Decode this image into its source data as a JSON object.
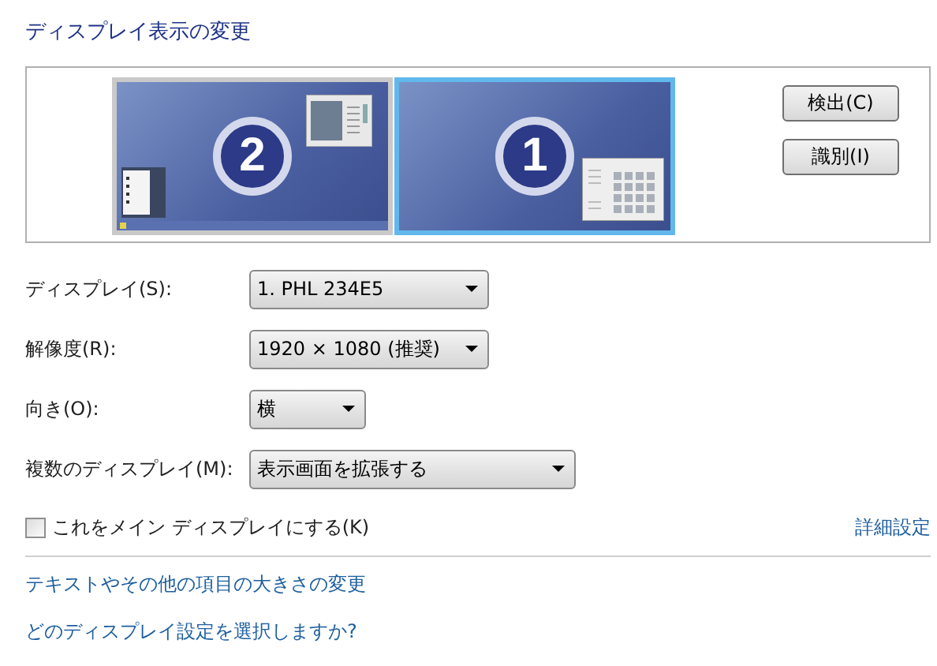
{
  "title": "ディスプレイ表示の変更",
  "monitors": [
    {
      "number": "2",
      "selected": false
    },
    {
      "number": "1",
      "selected": true
    }
  ],
  "buttons": [
    "検出(C)",
    "識別(I)"
  ],
  "settings": [
    {
      "label": "ディスプレイ(S):",
      "value": "1. PHL 234E5"
    },
    {
      "label": "解像度(R):",
      "value": "1920 × 1080 (推奨)"
    },
    {
      "label": "向き(O):",
      "value": "横"
    },
    {
      "label": "複数のディスプレイ(M):",
      "value": "表示画面を拡張する"
    }
  ],
  "main_display": {
    "label": "これをメイン ディスプレイにする(K)",
    "checked": false
  },
  "advanced_link": "詳細設定",
  "links": [
    "テキストやその他の項目の大きさの変更",
    "どのディスプレイ設定を選択しますか?"
  ]
}
